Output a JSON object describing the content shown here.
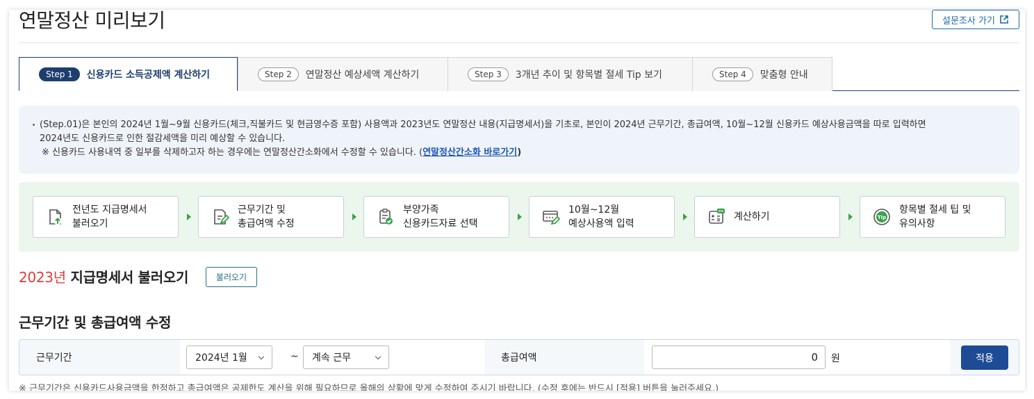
{
  "page": {
    "title": "연말정산 미리보기",
    "survey_label": "설문조사 가기"
  },
  "tabs": [
    {
      "step": "Step 1",
      "label": "신용카드 소득공제액 계산하기",
      "active": true
    },
    {
      "step": "Step 2",
      "label": "연말정산 예상세액 계산하기",
      "active": false
    },
    {
      "step": "Step 3",
      "label": "3개년 추이 및 항목별 절세 Tip 보기",
      "active": false
    },
    {
      "step": "Step 4",
      "label": "맞춤형 안내",
      "active": false
    }
  ],
  "info": {
    "line1": "(Step.01)은 본인의 2024년 1월~9월 신용카드(체크,직불카드 및 현금영수증 포함) 사용액과 2023년도 연말정산 내용(지급명세서)을 기초로, 본인이 2024년 근무기간, 총급여액, 10월~12월 신용카드 예상사용금액을 따로 입력하면",
    "line2": "2024년도 신용카드로 인한 절감세액을 미리 예상할 수 있습니다.",
    "note_prefix": "※ 신용카드 사용내역 중 일부를 삭제하고자 하는 경우에는 연말정산간소화에서 수정할 수 있습니다. (",
    "note_link": "연말정산간소화 바로가기",
    "note_suffix": ")"
  },
  "flow": [
    {
      "line1": "전년도 지급명세서",
      "line2": "불러오기",
      "icon": "document-upload-icon"
    },
    {
      "line1": "근무기간 및",
      "line2": "총급여액 수정",
      "icon": "document-edit-icon"
    },
    {
      "line1": "부양가족",
      "line2": "신용카드자료 선택",
      "icon": "clipboard-check-icon"
    },
    {
      "line1": "10월~12월",
      "line2": "예상사용액 입력",
      "icon": "screen-edit-icon"
    },
    {
      "line1": "계산하기",
      "line2": "",
      "icon": "calculator-icon"
    },
    {
      "line1": "항목별 절세 팁 및",
      "line2": "유의사항",
      "icon": "tip-icon"
    }
  ],
  "load_section": {
    "year": "2023년",
    "title": "지급명세서 불러오기",
    "button": "불러오기"
  },
  "edit_section": {
    "title": "근무기간 및 총급여액 수정",
    "period_label": "근무기간",
    "period_start": "2024년 1월",
    "tilde": "~",
    "period_end": "계속 근무",
    "salary_label": "총급여액",
    "salary_value": "0",
    "unit": "원",
    "apply": "적용"
  },
  "footnote": "※ 근무기간은 신용카드사용금액을 한정하고 총급여액은 공제한도 계산을 위해 필요하므로 올해의 상황에 맞게 수정하여 주시기 바랍니다. (수정 후에는 반드시 [적용] 버튼을 눌러주세요.)",
  "colors": {
    "navy": "#1d3f6e",
    "accent_red": "#e23b3b",
    "flow_bg": "#ebf7ec",
    "info_bg": "#eff3fa",
    "apply_bg": "#1d4b96"
  }
}
